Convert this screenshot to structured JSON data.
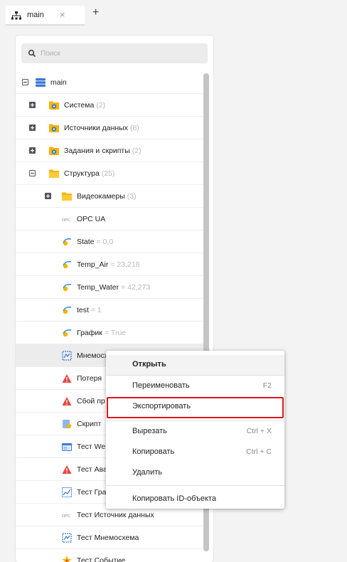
{
  "tab": {
    "title": "main",
    "close_symbol": "×",
    "add_symbol": "+"
  },
  "search": {
    "placeholder": "Поиск"
  },
  "tree": {
    "root": {
      "label": "main"
    },
    "items": [
      {
        "label": "Система",
        "meta": "(2)",
        "icon": "folder-gear-icon"
      },
      {
        "label": "Источники данных",
        "meta": "(8)",
        "icon": "folder-gear-icon"
      },
      {
        "label": "Задания и скрипты",
        "meta": "(2)",
        "icon": "folder-gear-icon"
      },
      {
        "label": "Структура",
        "meta": "(25)",
        "icon": "folder-icon"
      },
      {
        "label": "Видеокамеры",
        "meta": "(3)",
        "icon": "folder-icon"
      },
      {
        "label": "OPC UA",
        "meta": "",
        "icon": "opc-icon"
      },
      {
        "label": "State",
        "meta": "= 0,0",
        "icon": "variable-icon"
      },
      {
        "label": "Temp_Air",
        "meta": "= 23,218",
        "icon": "variable-icon"
      },
      {
        "label": "Temp_Water",
        "meta": "= 42,273",
        "icon": "variable-icon"
      },
      {
        "label": "test",
        "meta": "= 1",
        "icon": "variable-icon"
      },
      {
        "label": "График",
        "meta": "= True",
        "icon": "variable-icon"
      },
      {
        "label": "Мнемосхема",
        "meta": "",
        "icon": "mnemonic-icon"
      },
      {
        "label": "Потеря",
        "meta": "",
        "icon": "alarm-icon"
      },
      {
        "label": "Сбой пр",
        "meta": "",
        "icon": "alarm-icon"
      },
      {
        "label": "Скрипт",
        "meta": "",
        "icon": "script-icon"
      },
      {
        "label": "Тест We",
        "meta": "",
        "icon": "web-icon"
      },
      {
        "label": "Тест Ава",
        "meta": "",
        "icon": "alarm-icon"
      },
      {
        "label": "Тест Гра",
        "meta": "",
        "icon": "chart-icon"
      },
      {
        "label": "Тест Источник данных",
        "meta": "",
        "icon": "opc-icon"
      },
      {
        "label": "Тест Мнемосхема",
        "meta": "",
        "icon": "mnemonic-icon"
      },
      {
        "label": "Тест Событие",
        "meta": "",
        "icon": "event-icon"
      }
    ]
  },
  "context_menu": {
    "open": "Открыть",
    "rename": "Переименовать",
    "rename_shortcut": "F2",
    "export": "Экспортировать",
    "cut": "Вырезать",
    "cut_shortcut": "Ctrl + X",
    "copy": "Копировать",
    "copy_shortcut": "Ctrl + C",
    "delete": "Удалить",
    "copy_id": "Копировать ID-объекта"
  },
  "colors": {
    "accent_red": "#e0171b",
    "folder_yellow": "#f7b500",
    "gear_blue": "#3c78d8",
    "alarm_red": "#e8453c",
    "muted_text": "#b8b8b8"
  }
}
